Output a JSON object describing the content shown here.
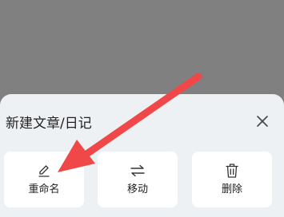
{
  "dialog": {
    "title": "新建文章/日记",
    "close_icon": "close-icon"
  },
  "actions": [
    {
      "label": "重命名",
      "icon": "pencil-icon"
    },
    {
      "label": "移动",
      "icon": "swap-arrows-icon"
    },
    {
      "label": "删除",
      "icon": "trash-icon"
    }
  ],
  "annotation": {
    "arrow_color": "#f04848"
  },
  "colors": {
    "overlay": "#808080",
    "sheet_background": "#eef1f4",
    "button_background": "#ffffff",
    "text": "#222222"
  }
}
